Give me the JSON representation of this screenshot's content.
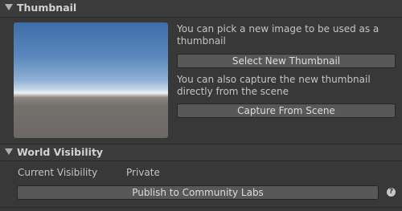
{
  "thumbnail_section": {
    "title": "Thumbnail",
    "pick_text": "You can pick a new image to be used as a thumbnail",
    "select_button": "Select New Thumbnail",
    "capture_text": "You can also capture the new thumbnail directly from the scene",
    "capture_button": "Capture From Scene"
  },
  "visibility_section": {
    "title": "World Visibility",
    "current_label": "Current Visibility",
    "current_value": "Private",
    "publish_button": "Publish to Community Labs",
    "help_icon": "question-circle-icon",
    "help_glyph": "?"
  },
  "colors": {
    "background": "#383838",
    "button": "#585858",
    "text": "#c8c8c8"
  }
}
